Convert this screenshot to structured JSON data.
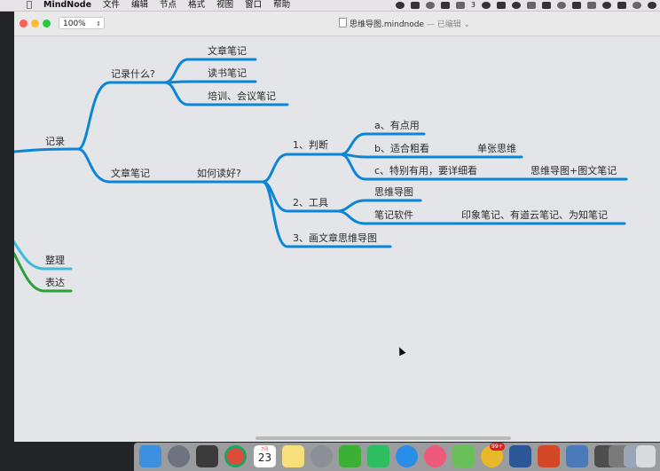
{
  "menubar": {
    "app_name": "MindNode",
    "items": [
      "文件",
      "编辑",
      "节点",
      "格式",
      "视图",
      "窗口",
      "帮助"
    ],
    "status_count": "3"
  },
  "window": {
    "zoom": "100%",
    "title": "思维导图.mindnode",
    "status": "— 已编辑"
  },
  "mindmap": {
    "colors": {
      "main": "#0b86d6",
      "teal": "#3bbcd9",
      "green": "#2e9e3a"
    },
    "nodes": {
      "record": "记录",
      "record_what": "记录什么?",
      "article_notes": "文章笔记",
      "reading_notes": "读书笔记",
      "training_notes": "培训、会议笔记",
      "article_notes_2": "文章笔记",
      "how_to_read": "如何读好?",
      "judge": "1、判断",
      "a_useful": "a、有点用",
      "b_skim": "b、适合粗看",
      "single_map": "单张思维",
      "c_detail": "c、特别有用，要详细看",
      "map_plus_notes": "思维导图+图文笔记",
      "tools": "2、工具",
      "mindmap_tool": "思维导图",
      "note_software": "笔记软件",
      "note_apps": "印象笔记、有道云笔记、为知笔记",
      "draw_map": "3、画文章思维导图",
      "organize": "整理",
      "express": "表达"
    }
  },
  "dock": {
    "calendar_month": "7月",
    "calendar_day": "23",
    "qq_badge": "99+",
    "icons": [
      "finder-icon",
      "launchpad-icon",
      "photo-booth-icon",
      "chrome-icon",
      "calendar-icon",
      "notes-icon",
      "system-preferences-icon",
      "wechat-icon",
      "evernote-icon",
      "safari-icon",
      "music-icon",
      "mindnode-icon",
      "qq-icon",
      "word-icon",
      "powerpoint-icon",
      "keynote-icon",
      "video-icon",
      "photos-icon",
      "downloads-icon",
      "trash-icon"
    ]
  }
}
